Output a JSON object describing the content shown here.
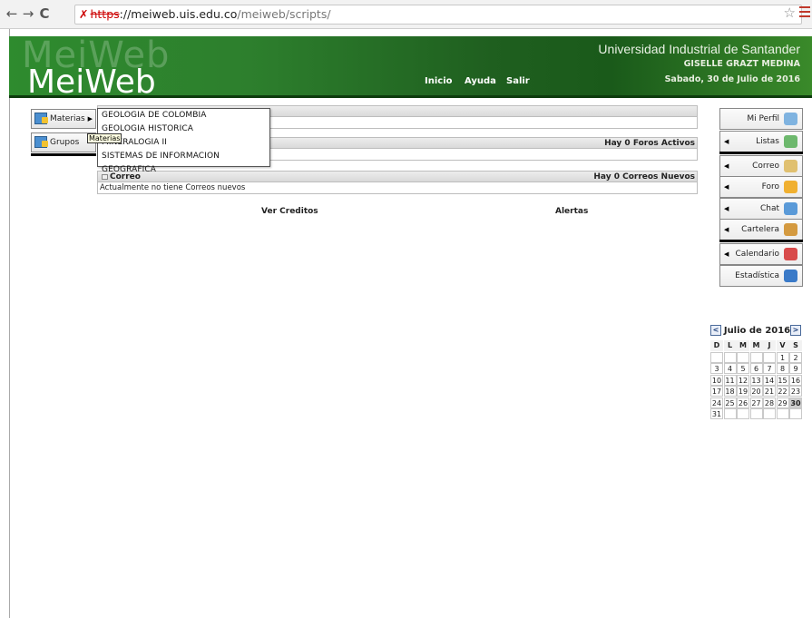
{
  "browser": {
    "back": "←",
    "forward": "→",
    "reload": "C",
    "url_scheme": "https",
    "url_host": "://meiweb.uis.edu.co",
    "url_path": "/meiweb/scripts/",
    "star": "☆"
  },
  "header": {
    "ghost_logo": "MeiWeb",
    "logo": "MeiWeb",
    "nav": [
      "Inicio",
      "Ayuda",
      "Salir"
    ],
    "university": "Universidad Industrial de Santander",
    "user": "GISELLE GRAZT MEDINA",
    "date": "Sabado, 30 de Julio de 2016"
  },
  "left_menu": [
    {
      "label": "Materias",
      "has_submenu": true
    },
    {
      "label": "Grupos",
      "has_submenu": false
    }
  ],
  "dropdown": {
    "items": [
      "GEOLOGIA DE COLOMBIA",
      "GEOLOGIA HISTORICA",
      "MINERALOGIA II",
      "SISTEMAS DE INFORMACION GEOGRAFICA"
    ],
    "tooltip": "Materias"
  },
  "panels": {
    "foros_status": "Hay 0 Foros Activos",
    "correo_title": "Correo",
    "correo_status": "Hay 0 Correos Nuevos",
    "correo_body": "Actualmente no tiene Correos nuevos"
  },
  "links": {
    "creditos": "Ver Creditos",
    "alertas": "Alertas"
  },
  "right_menu": [
    {
      "label": "Mi Perfil",
      "arrow": false,
      "icon": "profile-icon",
      "color": "#7fb3e0"
    },
    {
      "label": "Listas",
      "arrow": true,
      "icon": "lists-icon",
      "color": "#6db86d"
    },
    {
      "label": "Correo",
      "arrow": true,
      "icon": "mail-icon",
      "color": "#e0c070"
    },
    {
      "label": "Foro",
      "arrow": true,
      "icon": "forum-icon",
      "color": "#f0b030"
    },
    {
      "label": "Chat",
      "arrow": true,
      "icon": "chat-icon",
      "color": "#5a9ad8"
    },
    {
      "label": "Cartelera",
      "arrow": true,
      "icon": "board-icon",
      "color": "#d49a40"
    },
    {
      "label": "Calendario",
      "arrow": true,
      "icon": "calendar-icon",
      "color": "#d84a4a"
    },
    {
      "label": "Estadística",
      "arrow": false,
      "icon": "stats-icon",
      "color": "#3a7ac8"
    }
  ],
  "calendar": {
    "title": "Julio de 2016",
    "prev": "<",
    "next": ">",
    "weekdays": [
      "D",
      "L",
      "M",
      "M",
      "J",
      "V",
      "S"
    ],
    "cells": [
      "",
      "",
      "",
      "",
      "",
      "1",
      "2",
      "3",
      "4",
      "5",
      "6",
      "7",
      "8",
      "9",
      "10",
      "11",
      "12",
      "13",
      "14",
      "15",
      "16",
      "17",
      "18",
      "19",
      "20",
      "21",
      "22",
      "23",
      "24",
      "25",
      "26",
      "27",
      "28",
      "29",
      "30",
      "31",
      "",
      "",
      "",
      "",
      "",
      ""
    ],
    "selected": "30"
  }
}
